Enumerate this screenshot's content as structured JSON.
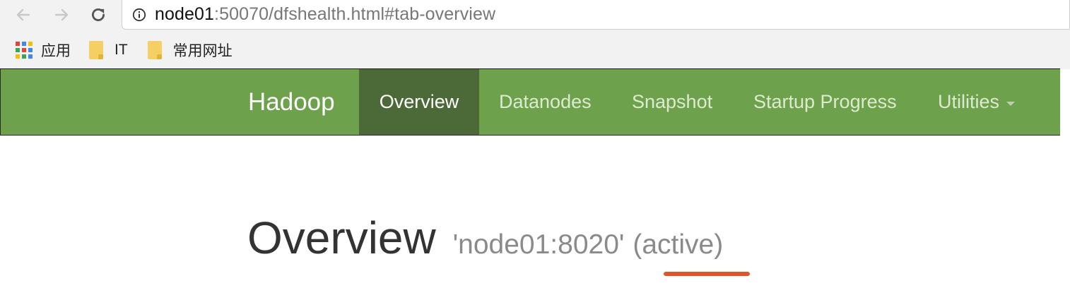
{
  "browser": {
    "url_host": "node01",
    "url_rest": ":50070/dfshealth.html#tab-overview",
    "bookmarks": [
      {
        "label": "应用",
        "icon": "apps-grid-icon"
      },
      {
        "label": "IT",
        "icon": "folder-icon"
      },
      {
        "label": "常用网址",
        "icon": "folder-icon"
      }
    ]
  },
  "navbar": {
    "brand": "Hadoop",
    "items": [
      {
        "label": "Overview",
        "active": true
      },
      {
        "label": "Datanodes",
        "active": false
      },
      {
        "label": "Snapshot",
        "active": false
      },
      {
        "label": "Startup Progress",
        "active": false
      },
      {
        "label": "Utilities",
        "active": false,
        "dropdown": true
      }
    ]
  },
  "page": {
    "title": "Overview",
    "subtitle": "'node01:8020'",
    "status": "(active)"
  },
  "colors": {
    "navbar_bg": "#6ea14c",
    "navbar_active_bg": "#4c6a37",
    "highlight_underline": "#e2542c"
  }
}
